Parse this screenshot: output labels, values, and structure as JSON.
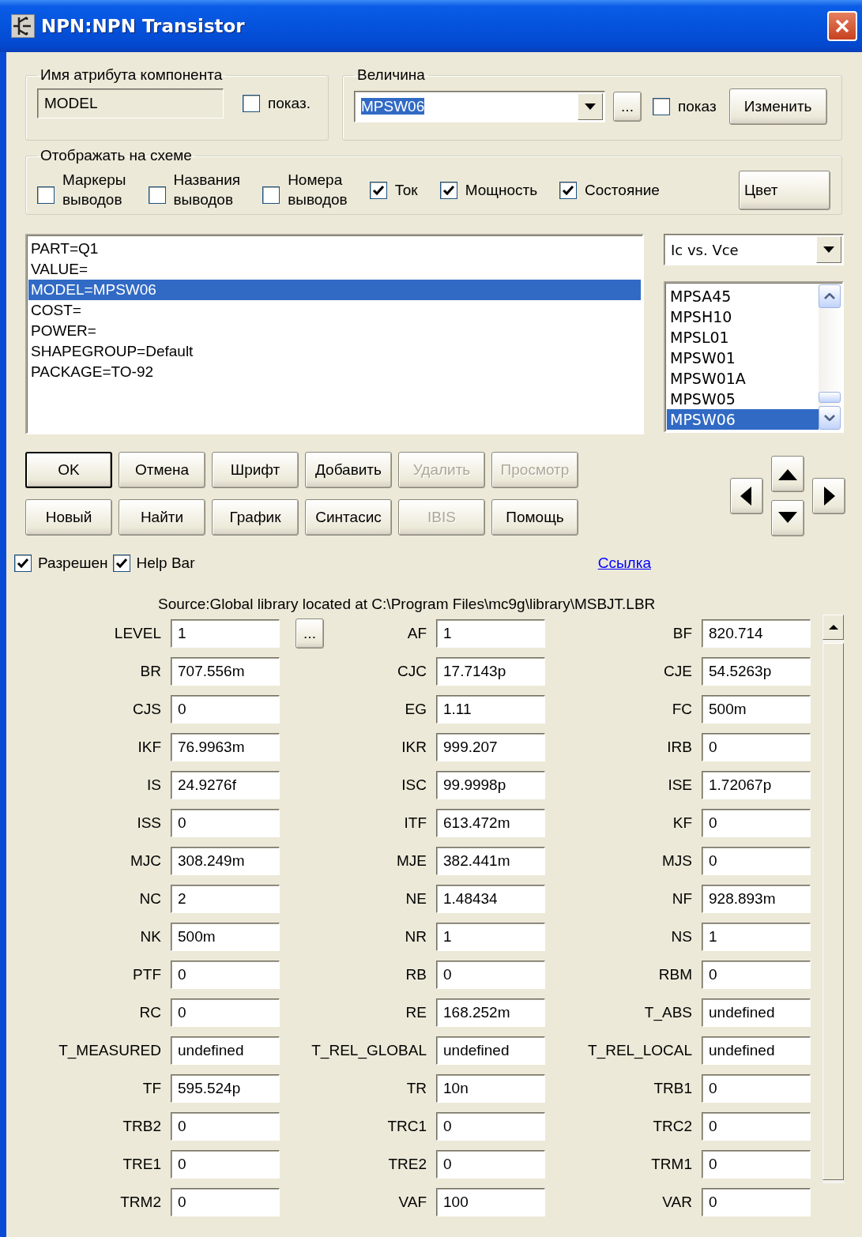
{
  "window": {
    "title": "NPN:NPN Transistor"
  },
  "attribute_name": {
    "label": "Имя атрибута компонента",
    "value": "MODEL",
    "show": {
      "label": "показ.",
      "checked": false
    }
  },
  "value_group": {
    "label": "Величина",
    "value": "MPSW06",
    "text_selected": true,
    "browse_button": "...",
    "show": {
      "label": "показ",
      "checked": false
    },
    "change_button": "Изменить"
  },
  "display": {
    "label": "Отображать на схеме",
    "options": [
      {
        "label": "Маркеры выводов",
        "checked": false
      },
      {
        "label": "Названия выводов",
        "checked": false
      },
      {
        "label": "Номера выводов",
        "checked": false
      },
      {
        "label": "Ток",
        "checked": true
      },
      {
        "label": "Мощность",
        "checked": true
      },
      {
        "label": "Состояние",
        "checked": true
      }
    ],
    "color_button": "Цвет"
  },
  "attributes": [
    {
      "text": "PART=Q1",
      "selected": false
    },
    {
      "text": "VALUE=",
      "selected": false
    },
    {
      "text": "MODEL=MPSW06",
      "selected": true
    },
    {
      "text": "COST=",
      "selected": false
    },
    {
      "text": "POWER=",
      "selected": false
    },
    {
      "text": "SHAPEGROUP=Default",
      "selected": false
    },
    {
      "text": "PACKAGE=TO-92",
      "selected": false
    }
  ],
  "plot_dropdown": {
    "value": "Ic vs. Vce"
  },
  "models": [
    {
      "text": "MPSA45",
      "selected": false
    },
    {
      "text": "MPSH10",
      "selected": false
    },
    {
      "text": "MPSL01",
      "selected": false
    },
    {
      "text": "MPSW01",
      "selected": false
    },
    {
      "text": "MPSW01A",
      "selected": false
    },
    {
      "text": "MPSW05",
      "selected": false
    },
    {
      "text": "MPSW06",
      "selected": true
    }
  ],
  "buttons": [
    [
      {
        "label": "OK",
        "default": true,
        "disabled": false
      },
      {
        "label": "Отмена",
        "default": false,
        "disabled": false
      },
      {
        "label": "Шрифт",
        "default": false,
        "disabled": false
      },
      {
        "label": "Добавить",
        "default": false,
        "disabled": false
      },
      {
        "label": "Удалить",
        "default": false,
        "disabled": true
      },
      {
        "label": "Просмотр",
        "default": false,
        "disabled": true
      }
    ],
    [
      {
        "label": "Новый",
        "default": false,
        "disabled": false
      },
      {
        "label": "Найти",
        "default": false,
        "disabled": false
      },
      {
        "label": "График",
        "default": false,
        "disabled": false
      },
      {
        "label": "Синтасис",
        "default": false,
        "disabled": false
      },
      {
        "label": "IBIS",
        "default": false,
        "disabled": true
      },
      {
        "label": "Помощь",
        "default": false,
        "disabled": false
      }
    ]
  ],
  "options": [
    {
      "label": "Разрешен",
      "checked": true
    },
    {
      "label": "Help Bar",
      "checked": true
    }
  ],
  "link": "Ссылка",
  "source": "Source:Global library located at C:\\Program Files\\mc9g\\library\\MSBJT.LBR",
  "params": [
    {
      "label": "LEVEL",
      "value": "1",
      "browse_button": "..."
    },
    {
      "label": "AF",
      "value": "1"
    },
    {
      "label": "BF",
      "value": "820.714"
    },
    {
      "label": "BR",
      "value": "707.556m"
    },
    {
      "label": "CJC",
      "value": "17.7143p"
    },
    {
      "label": "CJE",
      "value": "54.5263p"
    },
    {
      "label": "CJS",
      "value": "0"
    },
    {
      "label": "EG",
      "value": "1.11"
    },
    {
      "label": "FC",
      "value": "500m"
    },
    {
      "label": "IKF",
      "value": "76.9963m"
    },
    {
      "label": "IKR",
      "value": "999.207"
    },
    {
      "label": "IRB",
      "value": "0"
    },
    {
      "label": "IS",
      "value": "24.9276f"
    },
    {
      "label": "ISC",
      "value": "99.9998p"
    },
    {
      "label": "ISE",
      "value": "1.72067p"
    },
    {
      "label": "ISS",
      "value": "0"
    },
    {
      "label": "ITF",
      "value": "613.472m"
    },
    {
      "label": "KF",
      "value": "0"
    },
    {
      "label": "MJC",
      "value": "308.249m"
    },
    {
      "label": "MJE",
      "value": "382.441m"
    },
    {
      "label": "MJS",
      "value": "0"
    },
    {
      "label": "NC",
      "value": "2"
    },
    {
      "label": "NE",
      "value": "1.48434"
    },
    {
      "label": "NF",
      "value": "928.893m"
    },
    {
      "label": "NK",
      "value": "500m"
    },
    {
      "label": "NR",
      "value": "1"
    },
    {
      "label": "NS",
      "value": "1"
    },
    {
      "label": "PTF",
      "value": "0"
    },
    {
      "label": "RB",
      "value": "0"
    },
    {
      "label": "RBM",
      "value": "0"
    },
    {
      "label": "RC",
      "value": "0"
    },
    {
      "label": "RE",
      "value": "168.252m"
    },
    {
      "label": "T_ABS",
      "value": "undefined"
    },
    {
      "label": "T_MEASURED",
      "value": "undefined"
    },
    {
      "label": "T_REL_GLOBAL",
      "value": "undefined"
    },
    {
      "label": "T_REL_LOCAL",
      "value": "undefined"
    },
    {
      "label": "TF",
      "value": "595.524p"
    },
    {
      "label": "TR",
      "value": "10n"
    },
    {
      "label": "TRB1",
      "value": "0"
    },
    {
      "label": "TRB2",
      "value": "0"
    },
    {
      "label": "TRC1",
      "value": "0"
    },
    {
      "label": "TRC2",
      "value": "0"
    },
    {
      "label": "TRE1",
      "value": "0"
    },
    {
      "label": "TRE2",
      "value": "0"
    },
    {
      "label": "TRM1",
      "value": "0"
    },
    {
      "label": "TRM2",
      "value": "0"
    },
    {
      "label": "VAF",
      "value": "100"
    },
    {
      "label": "VAR",
      "value": "0"
    }
  ]
}
